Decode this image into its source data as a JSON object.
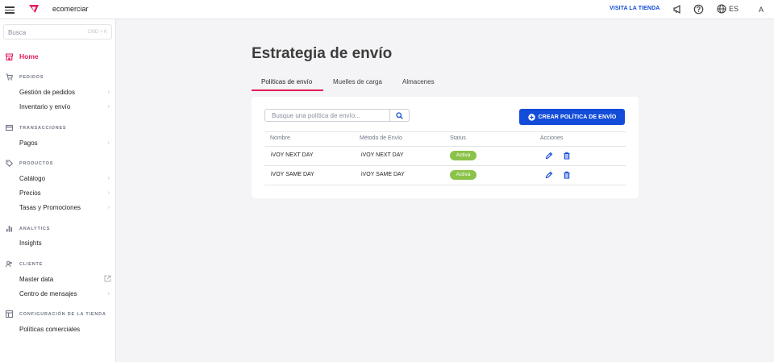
{
  "topbar": {
    "account_name": "ecomerciar",
    "visit_store": "VISITA LA TIENDA",
    "language": "ES",
    "avatar_initial": "A",
    "icons": [
      "menu-icon",
      "vtex-logo-icon",
      "megaphone-icon",
      "help-icon",
      "globe-icon"
    ]
  },
  "sidebar": {
    "search_placeholder": "Busca",
    "search_shortcut": "CMD + K",
    "home_label": "Home",
    "sections": {
      "pedidos": {
        "label": "PEDIDOS",
        "items": [
          "Gestión de pedidos",
          "Inventario y envío"
        ]
      },
      "transacciones": {
        "label": "TRANSACCIONES",
        "items": [
          "Pagos"
        ]
      },
      "productos": {
        "label": "PRODUCTOS",
        "items": [
          "Catálogo",
          "Precios",
          "Tasas y Promociones"
        ]
      },
      "analytics": {
        "label": "ANALYTICS",
        "items": [
          "Insights"
        ]
      },
      "cliente": {
        "label": "CLIENTE",
        "items": [
          "Master data",
          "Centro de mensajes"
        ]
      },
      "configuracion": {
        "label": "CONFIGURACIÓN DE LA TIENDA",
        "items": [
          "Políticas comerciales"
        ]
      }
    }
  },
  "main": {
    "title": "Estrategia de envío",
    "tabs": [
      "Políticas de envío",
      "Muelles de carga",
      "Almacenes"
    ],
    "active_tab": "Políticas de envío",
    "filter_placeholder": "Busque una política de envío...",
    "create_button": "CREAR POLÍTICA DE ENVÍO",
    "table": {
      "headers": [
        "Nombre",
        "Método de Envío",
        "Status",
        "Acciones"
      ],
      "rows": [
        {
          "name": "iVOY NEXT DAY",
          "method": "iVOY NEXT DAY",
          "status": "Activa"
        },
        {
          "name": "iVOY SAME DAY",
          "method": "iVOY SAME DAY",
          "status": "Activa"
        }
      ]
    }
  },
  "colors": {
    "accent": "#e31c58",
    "primary": "#134cd8",
    "status_active": "#8bc34a"
  }
}
